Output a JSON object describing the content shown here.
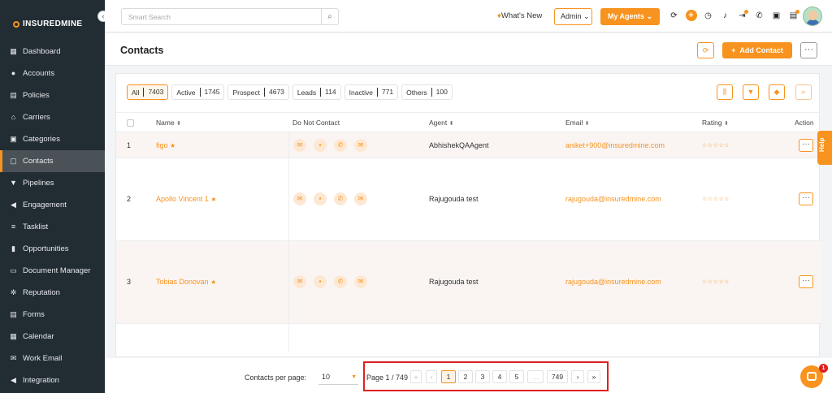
{
  "brand": {
    "bold": "INSUREDMINE",
    "light": ""
  },
  "sidebar": {
    "items": [
      {
        "label": "Dashboard",
        "icon": "dashboard-icon"
      },
      {
        "label": "Accounts",
        "icon": "accounts-icon"
      },
      {
        "label": "Policies",
        "icon": "policies-icon"
      },
      {
        "label": "Carriers",
        "icon": "carriers-icon"
      },
      {
        "label": "Categories",
        "icon": "categories-icon"
      },
      {
        "label": "Contacts",
        "icon": "contacts-icon",
        "active": true
      },
      {
        "label": "Pipelines",
        "icon": "pipelines-icon"
      },
      {
        "label": "Engagement",
        "icon": "engagement-icon"
      },
      {
        "label": "Tasklist",
        "icon": "tasklist-icon"
      },
      {
        "label": "Opportunities",
        "icon": "opportunities-icon"
      },
      {
        "label": "Document Manager",
        "icon": "folder-icon"
      },
      {
        "label": "Reputation",
        "icon": "reputation-icon"
      },
      {
        "label": "Forms",
        "icon": "forms-icon"
      },
      {
        "label": "Calendar",
        "icon": "calendar-icon"
      },
      {
        "label": "Work Email",
        "icon": "email-icon"
      },
      {
        "label": "Integration",
        "icon": "integration-icon"
      }
    ]
  },
  "topbar": {
    "search_placeholder": "Smart Search",
    "whats_new": "What's New",
    "role": "Admin",
    "my_agents": "My Agents"
  },
  "header": {
    "title": "Contacts",
    "add_contact": "Add Contact"
  },
  "filters": [
    {
      "label": "All",
      "count": "7403",
      "active": true
    },
    {
      "label": "Active",
      "count": "1745"
    },
    {
      "label": "Prospect",
      "count": "4673"
    },
    {
      "label": "Leads",
      "count": "114"
    },
    {
      "label": "Inactive",
      "count": "771"
    },
    {
      "label": "Others",
      "count": "100"
    }
  ],
  "table": {
    "columns": {
      "name": "Name",
      "dnc": "Do Not Contact",
      "agent": "Agent",
      "email": "Email",
      "rating": "Rating",
      "action": "Action"
    },
    "rows": [
      {
        "index": "1",
        "name": "figo",
        "agent": "AbhishekQAAgent",
        "email": "aniket+900@insuredmine.com"
      },
      {
        "index": "2",
        "name": "Apollo Vincent 1",
        "agent": "Rajugouda test",
        "email": "rajugouda@insuredmine.com"
      },
      {
        "index": "3",
        "name": "Tobias Donovan",
        "agent": "Rajugouda test",
        "email": "rajugouda@insuredmine.com"
      }
    ]
  },
  "help": "Help",
  "pagination": {
    "per_page_label": "Contacts per page:",
    "per_page_value": "10",
    "page_info": "Page 1 / 749",
    "pages": [
      "1",
      "2",
      "3",
      "4",
      "5",
      "...",
      "749"
    ]
  },
  "chat_badge": "1",
  "colors": {
    "accent": "#f7931e",
    "sidebar": "#222c33",
    "highlight": "#e02020"
  }
}
